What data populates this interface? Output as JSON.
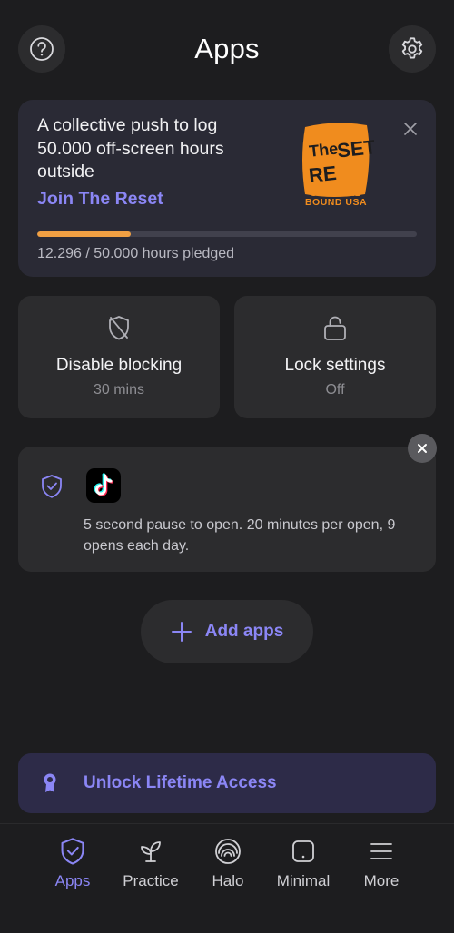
{
  "header": {
    "title": "Apps",
    "help_icon": "question-circle-icon",
    "settings_icon": "gear-icon"
  },
  "promo": {
    "text": "A collective push to log 50.000 off-screen hours outside",
    "link": "Join The Reset",
    "logo_text": "The RESET",
    "logo_subtitle": "OUTWARD BOUND USA",
    "progress_fraction": 0.246,
    "progress_label": "12.296 / 50.000 hours pledged",
    "progress_color": "#f1a043",
    "logo_color": "#f08c1e"
  },
  "tiles": [
    {
      "icon": "shield-off-icon",
      "title": "Disable blocking",
      "subtitle": "30 mins"
    },
    {
      "icon": "unlock-icon",
      "title": "Lock settings",
      "subtitle": "Off"
    }
  ],
  "rule": {
    "app_icon": "tiktok-icon",
    "text": "5 second pause to open. 20 minutes per open, 9 opens each day."
  },
  "add_apps": {
    "label": "Add apps"
  },
  "unlock": {
    "label": "Unlock Lifetime Access",
    "icon": "award-ribbon-icon"
  },
  "tabs": [
    {
      "label": "Apps",
      "icon": "shield-check-icon",
      "active": true
    },
    {
      "label": "Practice",
      "icon": "sprout-icon",
      "active": false
    },
    {
      "label": "Halo",
      "icon": "halo-icon",
      "active": false
    },
    {
      "label": "Minimal",
      "icon": "phone-square-icon",
      "active": false
    },
    {
      "label": "More",
      "icon": "menu-icon",
      "active": false
    }
  ],
  "colors": {
    "background": "#1d1d1f",
    "card": "#2c2c2e",
    "accent": "#8b86f5"
  }
}
